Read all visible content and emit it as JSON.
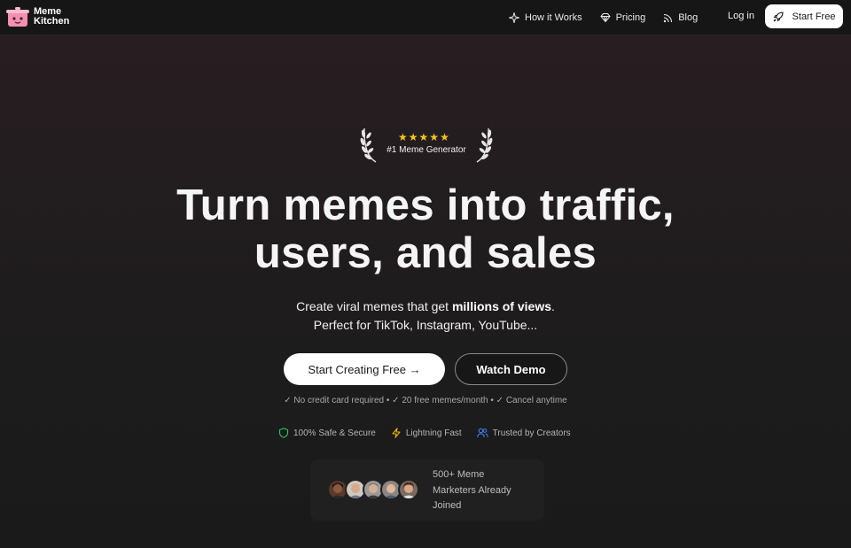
{
  "nav": {
    "logo_line1": "Meme",
    "logo_line2": "Kitchen",
    "links": [
      {
        "label": "How it Works",
        "icon": "sparkle-icon"
      },
      {
        "label": "Pricing",
        "icon": "diamond-icon"
      },
      {
        "label": "Blog",
        "icon": "rss-icon"
      }
    ],
    "login": "Log in",
    "start_free": "Start Free"
  },
  "badge": {
    "rating_stars": 5,
    "star_glyph": "★",
    "text": "#1 Meme Generator"
  },
  "hero": {
    "headline_line1": "Turn memes into traffic,",
    "headline_line2": "users, and sales",
    "sub_line1_a": "Create viral memes that get ",
    "sub_line1_bold": "millions of views",
    "sub_line1_b": ".",
    "sub_line2": "Perfect for TikTok, Instagram, YouTube..."
  },
  "cta": {
    "primary": "Start Creating Free →",
    "secondary": "Watch Demo",
    "fine_print": "✓ No credit card required • ✓ 20 free memes/month • ✓ Cancel anytime"
  },
  "trust": [
    {
      "label": "100% Safe & Secure",
      "icon": "shield-icon",
      "color": "#22c55e"
    },
    {
      "label": "Lightning Fast",
      "icon": "lightning-icon",
      "color": "#eab308"
    },
    {
      "label": "Trusted by Creators",
      "icon": "users-icon",
      "color": "#3b82f6"
    }
  ],
  "social_proof": {
    "text_line1": "500+ Meme",
    "text_line2": "Marketers Already",
    "text_line3": "Joined",
    "avatar_count": 5
  },
  "colors": {
    "accent_logo": "#f48fb1",
    "star": "#f5c518",
    "background_top": "#2a1d21",
    "background_bottom": "#1a1a1a"
  }
}
